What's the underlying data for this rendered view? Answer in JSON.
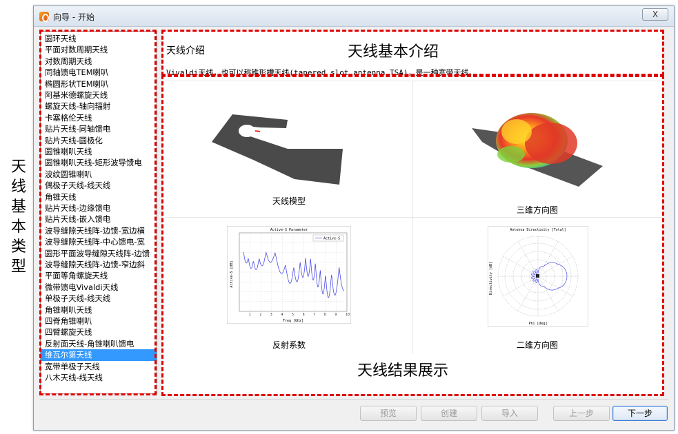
{
  "window": {
    "title": "向导 - 开始",
    "close_label": "X"
  },
  "annotations": {
    "left": [
      "天",
      "线",
      "基",
      "本",
      "类",
      "型"
    ],
    "top": "天线基本介绍",
    "bottom": "天线结果展示"
  },
  "antenna_list": {
    "items": [
      "圆环天线",
      "平面对数周期天线",
      "对数周期天线",
      "同轴馈电TEM喇叭",
      "椭圆形状TEM喇叭",
      "阿基米德螺旋天线",
      "螺旋天线-轴向辐射",
      "卡塞格伦天线",
      "贴片天线-同轴馈电",
      "贴片天线-圆极化",
      "圆锥喇叭天线",
      "圆锥喇叭天线-矩形波导馈电",
      "波纹圆锥喇叭",
      "偶极子天线-线天线",
      "角锥天线",
      "贴片天线-边缘馈电",
      "贴片天线-嵌入馈电",
      "波导缝隙天线阵-边馈-宽边横",
      "波导缝隙天线阵-中心馈电-宽",
      "圆形平面波导缝隙天线阵-边馈",
      "波导缝隙天线阵-边馈-窄边斜",
      "平面等角螺旋天线",
      "微带馈电Vivaldi天线",
      "单极子天线-线天线",
      "角锥喇叭天线",
      "四脊角锥喇叭",
      "四臂螺旋天线",
      "反射面天线-角锥喇叭馈电",
      "维瓦尔第天线",
      "宽带单极子天线",
      "八木天线-线天线"
    ],
    "selected_index": 28
  },
  "intro": {
    "heading": "天线介绍",
    "text": "Vivaldi天线，也可以称锥形槽天线(tapered slot antenna,TSA)，是一种宽带天线。"
  },
  "results": {
    "model_caption": "天线模型",
    "pattern3d_caption": "三维方向图",
    "s11_caption": "反射系数",
    "pattern2d_caption": "二维方向图",
    "s11_plot_title": "Active-S Parameter",
    "s11_legend": "Active-S",
    "s11_xlabel": "Freq [GHz]",
    "s11_ylabel": "Active-S [dB]",
    "s11_xticks": [
      "1",
      "2",
      "3",
      "4",
      "5",
      "6",
      "7",
      "8",
      "9",
      "10"
    ],
    "polar_title": "Antenna Directivity [Total]",
    "polar_xlabel": "Phi [deg]",
    "polar_ylabel": "Directivity [dB]"
  },
  "buttons": {
    "preview": "预览",
    "create": "创建",
    "import": "导入",
    "prev": "上一步",
    "next": "下一步"
  },
  "colors": {
    "annotation": "#e00000",
    "selection": "#3399ff",
    "plot_line": "#4a4ae8"
  }
}
